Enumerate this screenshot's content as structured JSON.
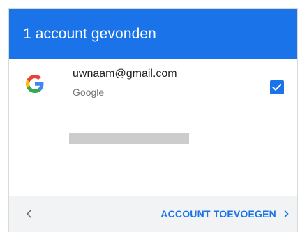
{
  "header": {
    "title": "1 account gevonden"
  },
  "account": {
    "email": "uwnaam@gmail.com",
    "provider": "Google",
    "checked": true,
    "logo_icon": "google-g-icon"
  },
  "footer": {
    "back_icon": "chevron-left-icon",
    "add_account_label": "ACCOUNT TOEVOEGEN",
    "add_account_icon": "chevron-right-icon"
  },
  "colors": {
    "accent": "#1a73e8",
    "footer_bg": "#f1f3f4",
    "placeholder": "#cccccc"
  }
}
